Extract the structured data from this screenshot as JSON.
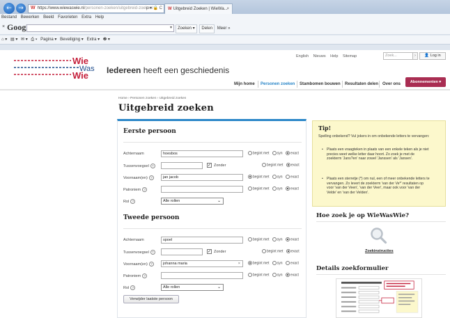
{
  "browser": {
    "url_domain": "https://www.wiewaswie.nl",
    "url_path": "/personen-zoeken/uitgebreid-zoeken/",
    "address_tools": "ρ ▾ 🔒 C",
    "tab_title": "Uitgebreid Zoeken | WieWa...",
    "tab_close": "×",
    "back_glyph": "←",
    "forward_glyph": "→",
    "menu": [
      "Bestand",
      "Bewerken",
      "Beeld",
      "Favorieten",
      "Extra",
      "Help"
    ],
    "google_logo": "Google",
    "google_tools": [
      "Zoeken ▾",
      "Delen",
      "Meer »"
    ],
    "commandbar": [
      "⌂ ▾",
      "▤ ▾",
      "✉ ▾",
      "⎙ ▾",
      "Pagina ▾",
      "Beveiliging ▾",
      "Extra ▾",
      "❷ ▾"
    ]
  },
  "site": {
    "logo_word_top": "Wie",
    "logo_word_mid": "Was",
    "logo_word_bot": "Wie",
    "tagline_bold": "Iedereen",
    "tagline_rest": " heeft een geschiedenis",
    "top_links": [
      "English",
      "Nieuws",
      "Help",
      "Sitemap"
    ],
    "search_placeholder": "Zoek...",
    "search_go": "›",
    "login_label": "👤 Log in",
    "nav": [
      {
        "label": "Mijn home",
        "active": false
      },
      {
        "label": "Personen zoeken",
        "active": true
      },
      {
        "label": "Stambomen bouwen",
        "active": false
      },
      {
        "label": "Resultaten delen",
        "active": false
      },
      {
        "label": "Over ons",
        "active": false
      }
    ],
    "subscribe_label": "Abonnementen ▾"
  },
  "page": {
    "breadcrumb": "Home  ›  Personen zoeken  ›  Uitgebreid zoeken",
    "title": "Uitgebreid zoeken"
  },
  "form": {
    "help_glyph": "?",
    "options_three": [
      "begint met",
      "syn",
      "exact"
    ],
    "options_two": [
      "begint met",
      "exact"
    ],
    "person1": {
      "title": "Eerste persoon",
      "achternaam_label": "Achternaam",
      "achternaam_value": "hoesbos",
      "achternaam_selected": "exact",
      "tussenvoegsel_label": "Tussenvoegsel",
      "tussenvoegsel_value": "",
      "zonder_label": "Zonder",
      "zonder_checked": true,
      "tussenvoegsel_selected": "exact",
      "voornamen_label": "Voornaam(en)",
      "voornamen_value": "jan jacob",
      "voornamen_selected": "begint met",
      "patroniem_label": "Patroniem",
      "patroniem_value": "",
      "patroniem_selected": "exact",
      "rol_label": "Rol",
      "rol_value": "Alle rollen"
    },
    "person2": {
      "title": "Tweede persoon",
      "achternaam_label": "Achternaam",
      "achternaam_value": "spoel",
      "achternaam_selected": "exact",
      "tussenvoegsel_label": "Tussenvoegsel",
      "tussenvoegsel_value": "",
      "zonder_label": "Zonder",
      "zonder_checked": true,
      "tussenvoegsel_selected": "exact",
      "voornamen_label": "Voornaam(en)",
      "voornamen_value": "johanna maria",
      "voornamen_clear": "×",
      "voornamen_selected": "begint met",
      "patroniem_label": "Patroniem",
      "patroniem_value": "",
      "patroniem_selected": "exact",
      "rol_label": "Rol",
      "rol_value": "Alle rollen"
    },
    "remove_label": "Verwijder laatste persoon"
  },
  "sidebar": {
    "tip_title": "Tip!",
    "tip_intro": "Spelling onbekend? Vul jokers in om onbekende letters te vervangen:",
    "tip_bullets": [
      "Plaats een vraagteken in plaats van een enkele teken als je niet precies weet welke letter daar hoort. Zo zoek je met de zoekterm 'Jans?en' naar zowel 'Janssen' als 'Jansen'.",
      "Plaats een sterretje (*) om nul, een of meer onbekende letters te vervangen. Zo levert de zoekterm 'van der Ve*' resultaten op voor 'van der Veen', 'van der Veer', maar ook voor 'van der Velde' en 'van der Velden'."
    ],
    "how_title": "Hoe zoek je op WieWasWie?",
    "instructions_link": "Zoekinstructies",
    "details_title": "Details zoekformulier"
  },
  "colors": {
    "accent_blue": "#2a86c8",
    "logo_blue": "#1f4d8c",
    "logo_red": "#c41e3a",
    "subscribe_bg": "#a92d52",
    "tip_bg": "#fcf8cc"
  }
}
